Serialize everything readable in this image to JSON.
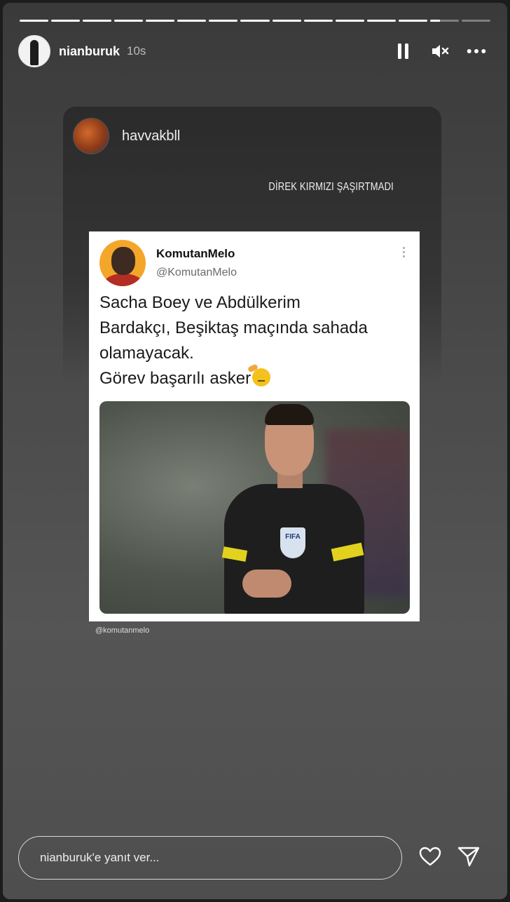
{
  "story": {
    "progress_segments": [
      1,
      1,
      1,
      1,
      1,
      1,
      1,
      1,
      1,
      1,
      1,
      1,
      1,
      0.35,
      0
    ],
    "username": "nianburuk",
    "time": "10s"
  },
  "controls": {
    "pause_icon": "pause-icon",
    "mute_icon": "speaker-muted-icon",
    "more_icon": "more-horizontal-icon"
  },
  "repost": {
    "username": "havvakbll",
    "caption": "DİREK KIRMIZI ŞAŞIRTMADI"
  },
  "tweet": {
    "display_name": "KomutanMelo",
    "handle": "@KomutanMelo",
    "lines": [
      "Sacha Boey ve Abdülkerim",
      "Bardakçı, Beşiktaş maçında sahada",
      "olamayacak.",
      "Görev başarılı asker"
    ],
    "badge_text": "FIFA",
    "watermark": "@komutanmelo"
  },
  "reply": {
    "placeholder": "nianburuk'e yanıt ver..."
  }
}
